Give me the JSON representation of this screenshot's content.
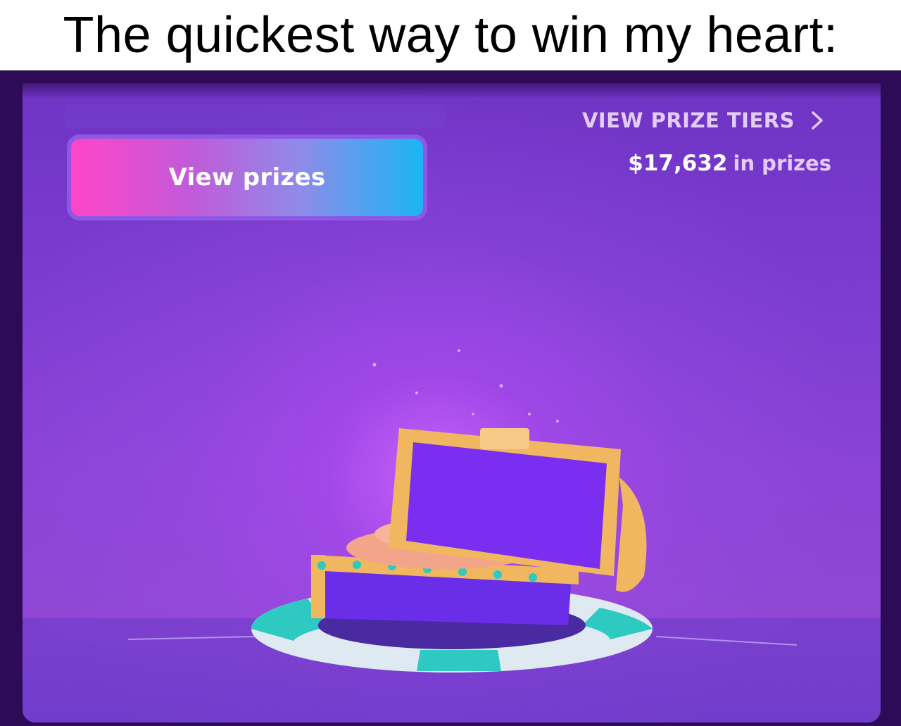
{
  "caption": "The quickest way to win my heart:",
  "prize_panel": {
    "button_label": "View prizes",
    "tiers_link": "VIEW PRIZE TIERS",
    "prize_amount": "$17,632",
    "prize_suffix": "in prizes"
  },
  "icons": {
    "tiers_chevron": "chevron-right-icon",
    "chest": "treasure-chest-icon"
  },
  "colors": {
    "button_gradient_start": "#ff45c7",
    "button_gradient_end": "#19b6f4",
    "panel_background": "#7a3ccf",
    "frame_background": "#2d0b57"
  }
}
